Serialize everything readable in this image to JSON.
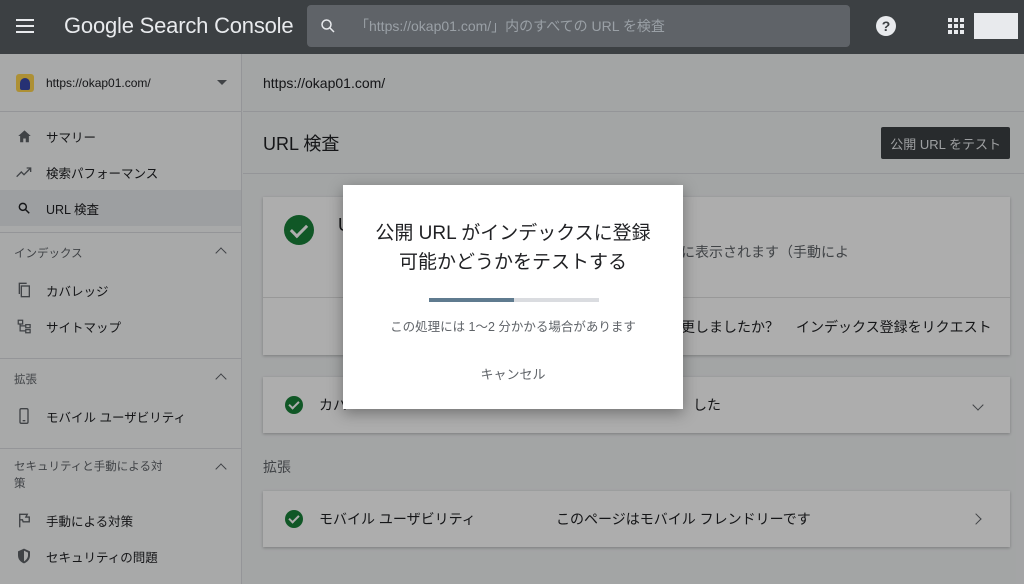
{
  "topbar": {
    "brand": "Google Search Console",
    "search_placeholder": "「https://okap01.com/」内のすべての URL を検査"
  },
  "sidebar": {
    "property": "https://okap01.com/",
    "items_top": [
      {
        "label": "サマリー",
        "icon": "home-icon"
      },
      {
        "label": "検索パフォーマンス",
        "icon": "trending-up-icon"
      },
      {
        "label": "URL 検査",
        "icon": "search-icon"
      }
    ],
    "index_section": {
      "title": "インデックス",
      "items": [
        {
          "label": "カバレッジ",
          "icon": "copy-icon"
        },
        {
          "label": "サイトマップ",
          "icon": "sitemap-icon"
        }
      ]
    },
    "enhance_section": {
      "title": "拡張",
      "items": [
        {
          "label": "モバイル ユーザビリティ",
          "icon": "phone-icon"
        }
      ]
    },
    "security_section": {
      "title": "セキュリティと手動による対策",
      "items": [
        {
          "label": "手動による対策",
          "icon": "flag-icon"
        },
        {
          "label": "セキュリティの問題",
          "icon": "shield-icon"
        }
      ]
    }
  },
  "main": {
    "url": "https://okap01.com/",
    "title": "URL 検査",
    "test_button": "公開 URL をテスト",
    "status_card": {
      "headline": "U",
      "line1_visible": "に表示されます（手動によ",
      "line2_right": "更しましたか？",
      "request_link": "インデックス登録をリクエスト"
    },
    "coverage_row": {
      "label": "カバ",
      "value": "した"
    },
    "enhance_label": "拡張",
    "mobile_row": {
      "label": "モバイル ユーザビリティ",
      "value": "このページはモバイル フレンドリーです"
    }
  },
  "dialog": {
    "title": "公開 URL がインデックスに登録可能かどうかをテストする",
    "note": "この処理には 1〜2 分かかる場合があります",
    "cancel": "キャンセル",
    "progress": 0.5
  }
}
